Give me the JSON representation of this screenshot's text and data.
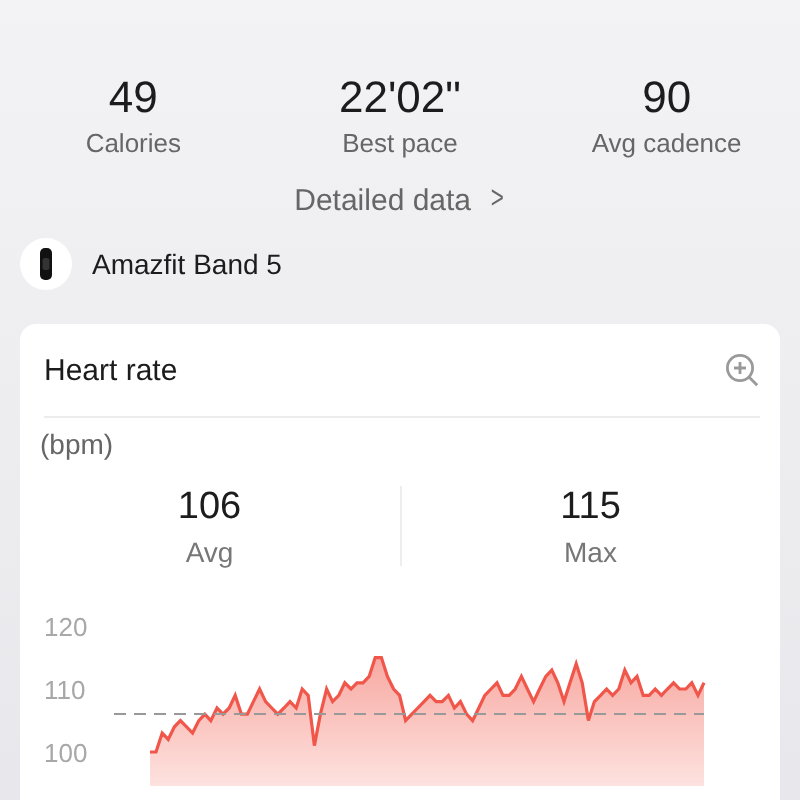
{
  "summary_stats": [
    {
      "value": "49",
      "label": "Calories"
    },
    {
      "value": "22'02\"",
      "label": "Best pace"
    },
    {
      "value": "90",
      "label": "Avg cadence"
    }
  ],
  "detail_link": {
    "label": "Detailed data",
    "chevron": ">"
  },
  "device": {
    "name": "Amazfit Band 5"
  },
  "heart_rate_card": {
    "title": "Heart rate",
    "unit": "(bpm)",
    "stats": [
      {
        "value": "106",
        "label": "Avg"
      },
      {
        "value": "115",
        "label": "Max"
      }
    ],
    "chart_data": {
      "type": "area",
      "ylim": [
        100,
        120
      ],
      "yticks": [
        100,
        110,
        120
      ],
      "series": [
        {
          "color": "#f0564a",
          "values": [
            100,
            100,
            103,
            102,
            104,
            105,
            104,
            103,
            105,
            106,
            105,
            107,
            106,
            107,
            109,
            106,
            106,
            108,
            110,
            108,
            107,
            106,
            107,
            108,
            107,
            110,
            109,
            101,
            106,
            110,
            108,
            109,
            111,
            110,
            111,
            111,
            112,
            115,
            115,
            112,
            110,
            109,
            105,
            106,
            107,
            108,
            109,
            108,
            108,
            109,
            107,
            108,
            106,
            105,
            107,
            109,
            110,
            111,
            109,
            109,
            110,
            112,
            110,
            108,
            110,
            112,
            113,
            111,
            108,
            111,
            114,
            111,
            105,
            108,
            109,
            110,
            109,
            110,
            113,
            111,
            112,
            109,
            109,
            110,
            109,
            110,
            111,
            110,
            110,
            111,
            109,
            111
          ]
        }
      ]
    }
  }
}
